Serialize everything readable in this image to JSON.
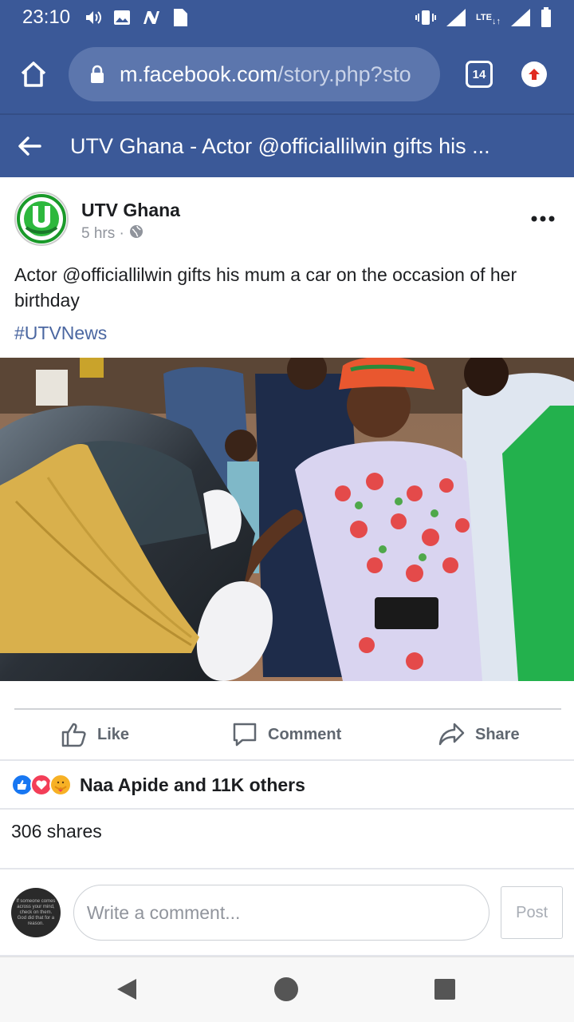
{
  "status_bar": {
    "time": "23:10",
    "lte": "LTE",
    "icons": [
      "volume-icon",
      "image-icon",
      "n-icon",
      "file-icon",
      "vibrate-icon",
      "signal-icon",
      "lte-icon",
      "signal-icon",
      "battery-icon"
    ]
  },
  "browser": {
    "url_domain": "m.facebook.com",
    "url_path": "/story.php?sto",
    "tab_count": "14"
  },
  "header": {
    "title": "UTV Ghana - Actor @officiallilwin gifts his ..."
  },
  "post": {
    "page_name": "UTV Ghana",
    "time": "5 hrs ·",
    "text": "Actor @officiallilwin gifts his mum a car on the occasion of her birthday",
    "hashtag": "#UTVNews"
  },
  "actions": {
    "like": "Like",
    "comment": "Comment",
    "share": "Share"
  },
  "reactions": {
    "summary": "Naa Apide and 11K others",
    "types": [
      "like-icon",
      "love-icon",
      "care-icon"
    ]
  },
  "shares": "306 shares",
  "composer": {
    "avatar_text": "If someone comes across your mind, check on them. God did that for a reason.",
    "placeholder": "Write a comment...",
    "post_label": "Post"
  },
  "colors": {
    "facebook_blue": "#3b5998",
    "link": "#4b67a1",
    "url_bar": "#5c76ad"
  }
}
